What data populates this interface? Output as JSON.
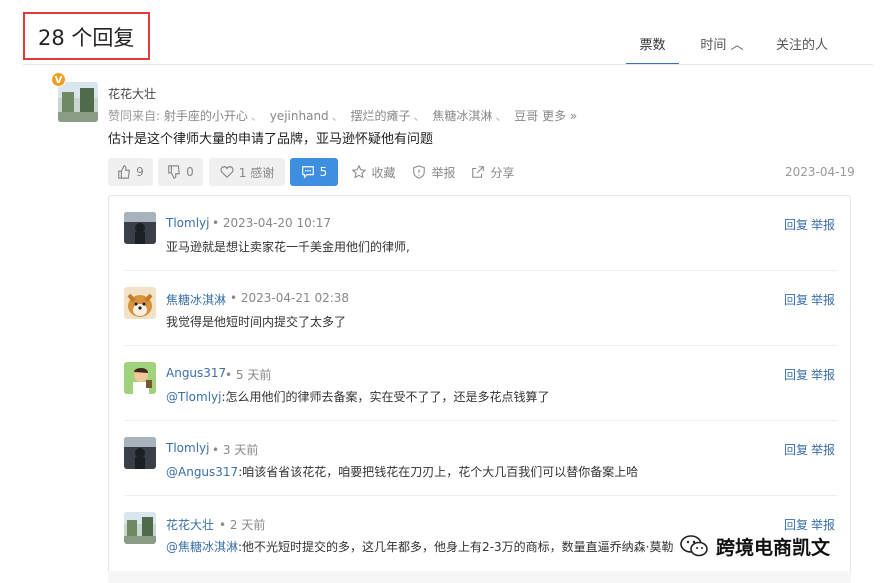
{
  "header": {
    "title": "28 个回复"
  },
  "tabs": [
    {
      "label": "票数",
      "active": true
    },
    {
      "label": "时间 ︿",
      "active": false
    },
    {
      "label": "关注的人",
      "active": false
    }
  ],
  "answer": {
    "badge": "V",
    "author": "花花大壮",
    "voters_prefix": "赞同来自:",
    "voters": [
      "射手座的小开心",
      "yejinhand",
      "摆烂的瘫子",
      "焦糖冰淇淋",
      "豆哥"
    ],
    "voters_more": "更多 »",
    "content": "估计是这个律师大量的申请了品牌，亚马逊怀疑他有问题",
    "actions": {
      "upvote": "9",
      "downvote": "0",
      "thanks": "1 感谢",
      "comments": "5",
      "collect": "收藏",
      "report": "举报",
      "share": "分享"
    },
    "date": "2023-04-19"
  },
  "comments": [
    {
      "author": "Tlomlyj",
      "meta": "• 2023-04-20 10:17",
      "mention": "",
      "text": "亚马逊就是想让卖家花一千美金用他们的律师,",
      "reply": "回复",
      "report": "举报"
    },
    {
      "author": "焦糖冰淇淋",
      "meta": "• 2023-04-21 02:38",
      "mention": "",
      "text": "我觉得是他短时间内提交了太多了",
      "reply": "回复",
      "report": "举报"
    },
    {
      "author": "Angus317",
      "meta": "• 5 天前",
      "mention": "@Tlomlyj",
      "text": ":怎么用他们的律师去备案，实在受不了了，还是多花点钱算了",
      "reply": "回复",
      "report": "举报"
    },
    {
      "author": "Tlomlyj",
      "meta": "• 3 天前",
      "mention": "@Angus317",
      "text": ":咱该省省该花花，咱要把钱花在刀刃上，花个大几百我们可以替你备案上哈",
      "reply": "回复",
      "report": "举报"
    },
    {
      "author": "花花大壮",
      "meta": "• 2 天前",
      "mention": "@焦糖冰淇淋",
      "text": ":他不光短时提交的多，这几年都多，他身上有2-3万的商标，数量直逼乔纳森·莫勒",
      "reply": "回复",
      "report": "举报"
    }
  ],
  "watermark": {
    "text": "跨境电商凯文"
  },
  "colors": {
    "link": "#3a6fa8",
    "primary_button": "#3e8fe0",
    "highlight_box": "#e23a3a",
    "badge": "#f0a020"
  }
}
